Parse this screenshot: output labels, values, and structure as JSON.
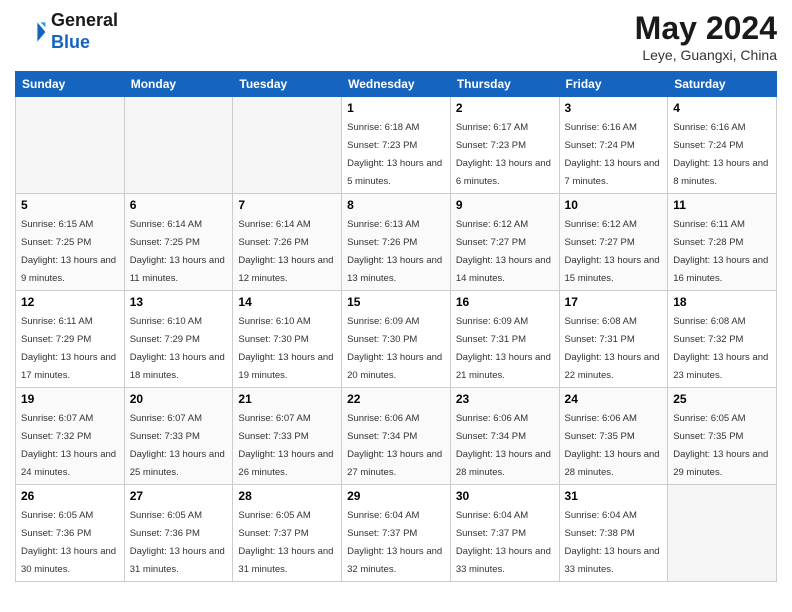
{
  "header": {
    "logo_line1": "General",
    "logo_line2": "Blue",
    "month": "May 2024",
    "location": "Leye, Guangxi, China"
  },
  "weekdays": [
    "Sunday",
    "Monday",
    "Tuesday",
    "Wednesday",
    "Thursday",
    "Friday",
    "Saturday"
  ],
  "weeks": [
    [
      {
        "day": "",
        "empty": true
      },
      {
        "day": "",
        "empty": true
      },
      {
        "day": "",
        "empty": true
      },
      {
        "day": "1",
        "sunrise": "Sunrise: 6:18 AM",
        "sunset": "Sunset: 7:23 PM",
        "daylight": "Daylight: 13 hours and 5 minutes."
      },
      {
        "day": "2",
        "sunrise": "Sunrise: 6:17 AM",
        "sunset": "Sunset: 7:23 PM",
        "daylight": "Daylight: 13 hours and 6 minutes."
      },
      {
        "day": "3",
        "sunrise": "Sunrise: 6:16 AM",
        "sunset": "Sunset: 7:24 PM",
        "daylight": "Daylight: 13 hours and 7 minutes."
      },
      {
        "day": "4",
        "sunrise": "Sunrise: 6:16 AM",
        "sunset": "Sunset: 7:24 PM",
        "daylight": "Daylight: 13 hours and 8 minutes."
      }
    ],
    [
      {
        "day": "5",
        "sunrise": "Sunrise: 6:15 AM",
        "sunset": "Sunset: 7:25 PM",
        "daylight": "Daylight: 13 hours and 9 minutes."
      },
      {
        "day": "6",
        "sunrise": "Sunrise: 6:14 AM",
        "sunset": "Sunset: 7:25 PM",
        "daylight": "Daylight: 13 hours and 11 minutes."
      },
      {
        "day": "7",
        "sunrise": "Sunrise: 6:14 AM",
        "sunset": "Sunset: 7:26 PM",
        "daylight": "Daylight: 13 hours and 12 minutes."
      },
      {
        "day": "8",
        "sunrise": "Sunrise: 6:13 AM",
        "sunset": "Sunset: 7:26 PM",
        "daylight": "Daylight: 13 hours and 13 minutes."
      },
      {
        "day": "9",
        "sunrise": "Sunrise: 6:12 AM",
        "sunset": "Sunset: 7:27 PM",
        "daylight": "Daylight: 13 hours and 14 minutes."
      },
      {
        "day": "10",
        "sunrise": "Sunrise: 6:12 AM",
        "sunset": "Sunset: 7:27 PM",
        "daylight": "Daylight: 13 hours and 15 minutes."
      },
      {
        "day": "11",
        "sunrise": "Sunrise: 6:11 AM",
        "sunset": "Sunset: 7:28 PM",
        "daylight": "Daylight: 13 hours and 16 minutes."
      }
    ],
    [
      {
        "day": "12",
        "sunrise": "Sunrise: 6:11 AM",
        "sunset": "Sunset: 7:29 PM",
        "daylight": "Daylight: 13 hours and 17 minutes."
      },
      {
        "day": "13",
        "sunrise": "Sunrise: 6:10 AM",
        "sunset": "Sunset: 7:29 PM",
        "daylight": "Daylight: 13 hours and 18 minutes."
      },
      {
        "day": "14",
        "sunrise": "Sunrise: 6:10 AM",
        "sunset": "Sunset: 7:30 PM",
        "daylight": "Daylight: 13 hours and 19 minutes."
      },
      {
        "day": "15",
        "sunrise": "Sunrise: 6:09 AM",
        "sunset": "Sunset: 7:30 PM",
        "daylight": "Daylight: 13 hours and 20 minutes."
      },
      {
        "day": "16",
        "sunrise": "Sunrise: 6:09 AM",
        "sunset": "Sunset: 7:31 PM",
        "daylight": "Daylight: 13 hours and 21 minutes."
      },
      {
        "day": "17",
        "sunrise": "Sunrise: 6:08 AM",
        "sunset": "Sunset: 7:31 PM",
        "daylight": "Daylight: 13 hours and 22 minutes."
      },
      {
        "day": "18",
        "sunrise": "Sunrise: 6:08 AM",
        "sunset": "Sunset: 7:32 PM",
        "daylight": "Daylight: 13 hours and 23 minutes."
      }
    ],
    [
      {
        "day": "19",
        "sunrise": "Sunrise: 6:07 AM",
        "sunset": "Sunset: 7:32 PM",
        "daylight": "Daylight: 13 hours and 24 minutes."
      },
      {
        "day": "20",
        "sunrise": "Sunrise: 6:07 AM",
        "sunset": "Sunset: 7:33 PM",
        "daylight": "Daylight: 13 hours and 25 minutes."
      },
      {
        "day": "21",
        "sunrise": "Sunrise: 6:07 AM",
        "sunset": "Sunset: 7:33 PM",
        "daylight": "Daylight: 13 hours and 26 minutes."
      },
      {
        "day": "22",
        "sunrise": "Sunrise: 6:06 AM",
        "sunset": "Sunset: 7:34 PM",
        "daylight": "Daylight: 13 hours and 27 minutes."
      },
      {
        "day": "23",
        "sunrise": "Sunrise: 6:06 AM",
        "sunset": "Sunset: 7:34 PM",
        "daylight": "Daylight: 13 hours and 28 minutes."
      },
      {
        "day": "24",
        "sunrise": "Sunrise: 6:06 AM",
        "sunset": "Sunset: 7:35 PM",
        "daylight": "Daylight: 13 hours and 28 minutes."
      },
      {
        "day": "25",
        "sunrise": "Sunrise: 6:05 AM",
        "sunset": "Sunset: 7:35 PM",
        "daylight": "Daylight: 13 hours and 29 minutes."
      }
    ],
    [
      {
        "day": "26",
        "sunrise": "Sunrise: 6:05 AM",
        "sunset": "Sunset: 7:36 PM",
        "daylight": "Daylight: 13 hours and 30 minutes."
      },
      {
        "day": "27",
        "sunrise": "Sunrise: 6:05 AM",
        "sunset": "Sunset: 7:36 PM",
        "daylight": "Daylight: 13 hours and 31 minutes."
      },
      {
        "day": "28",
        "sunrise": "Sunrise: 6:05 AM",
        "sunset": "Sunset: 7:37 PM",
        "daylight": "Daylight: 13 hours and 31 minutes."
      },
      {
        "day": "29",
        "sunrise": "Sunrise: 6:04 AM",
        "sunset": "Sunset: 7:37 PM",
        "daylight": "Daylight: 13 hours and 32 minutes."
      },
      {
        "day": "30",
        "sunrise": "Sunrise: 6:04 AM",
        "sunset": "Sunset: 7:37 PM",
        "daylight": "Daylight: 13 hours and 33 minutes."
      },
      {
        "day": "31",
        "sunrise": "Sunrise: 6:04 AM",
        "sunset": "Sunset: 7:38 PM",
        "daylight": "Daylight: 13 hours and 33 minutes."
      },
      {
        "day": "",
        "empty": true
      }
    ]
  ]
}
